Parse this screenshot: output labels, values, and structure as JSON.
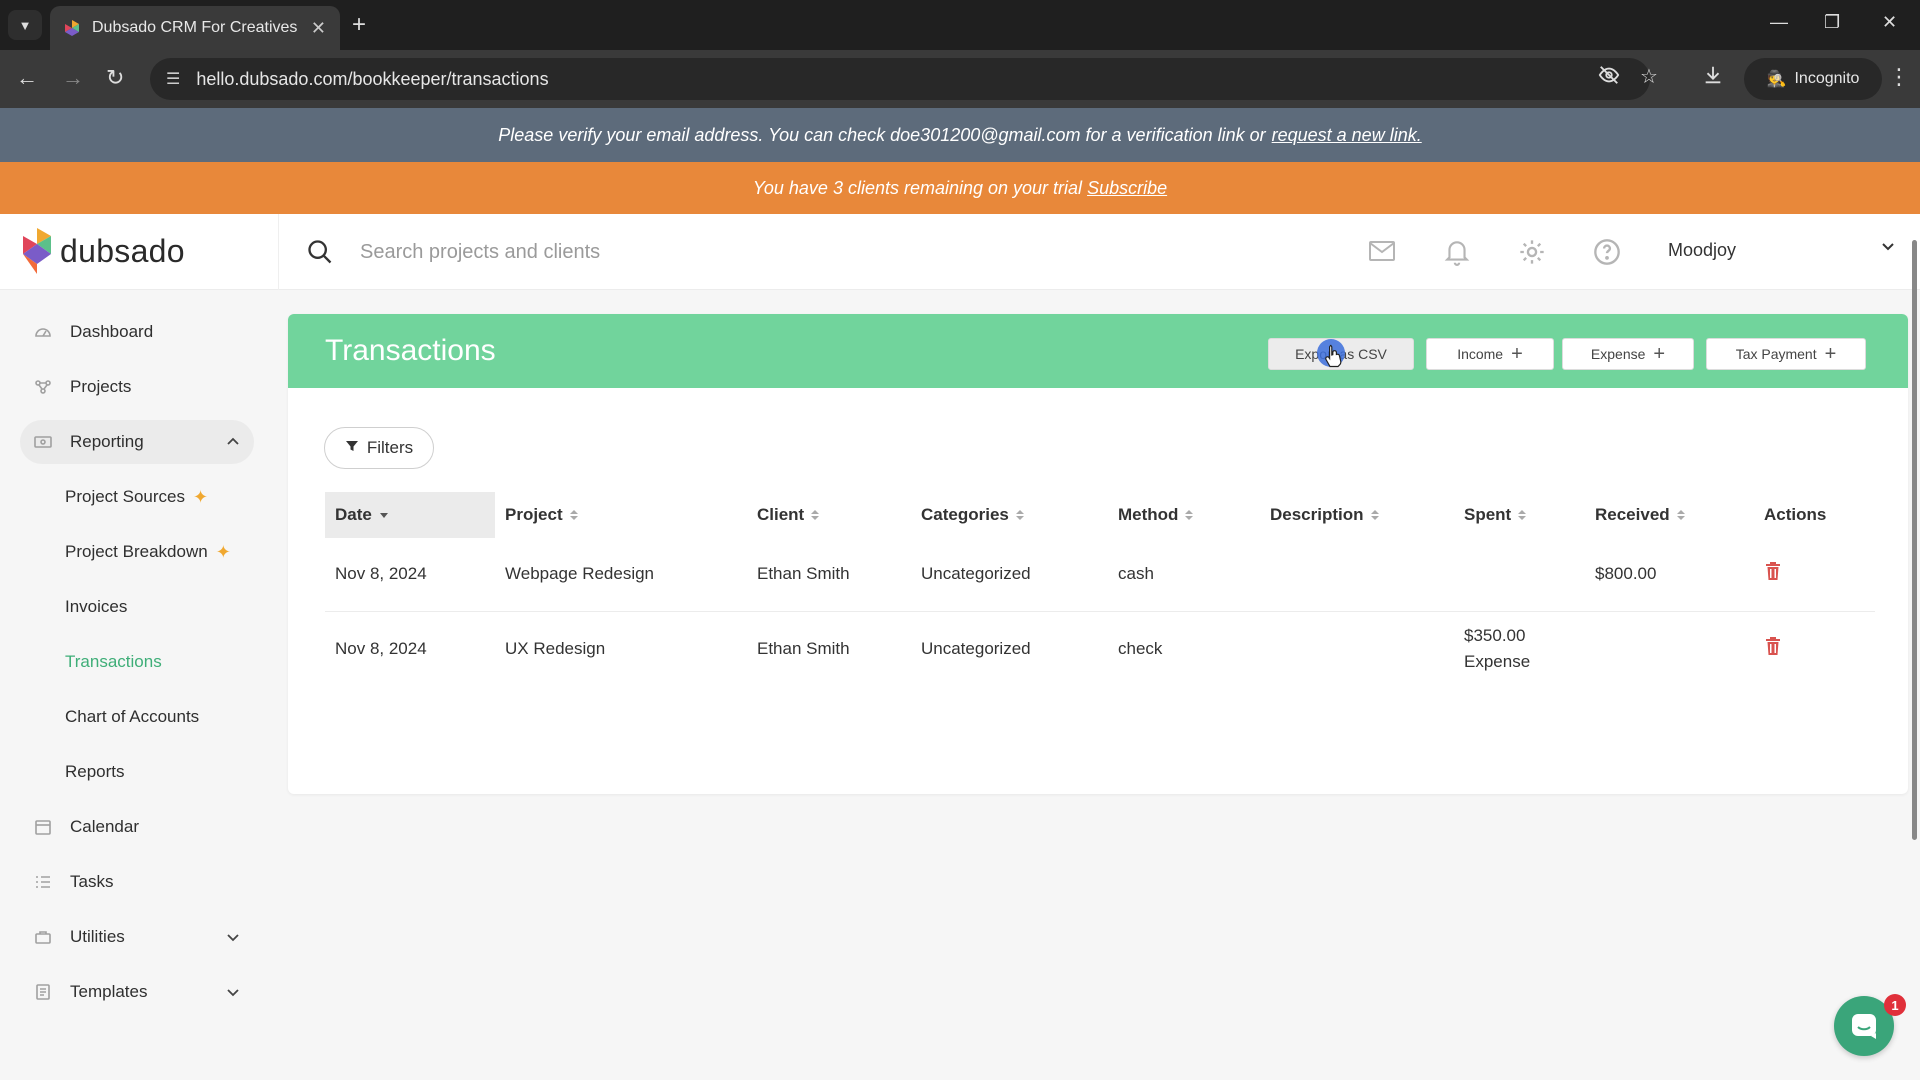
{
  "browser": {
    "tab_title": "Dubsado CRM For Creatives",
    "url": "hello.dubsado.com/bookkeeper/transactions",
    "incognito_label": "Incognito"
  },
  "banners": {
    "verify_text": "Please verify your email address. You can check doe301200@gmail.com for a verification link or",
    "verify_link": "request a new link.",
    "trial_text": "You have 3 clients remaining on your trial",
    "trial_link": "Subscribe"
  },
  "header": {
    "logo_text": "dubsado",
    "search_placeholder": "Search projects and clients",
    "search_value": "",
    "user_name": "Moodjoy"
  },
  "sidebar": {
    "items": [
      {
        "label": "Dashboard",
        "icon": "gauge-icon"
      },
      {
        "label": "Projects",
        "icon": "projects-icon"
      },
      {
        "label": "Reporting",
        "icon": "reporting-icon",
        "expanded": true
      },
      {
        "label": "Calendar",
        "icon": "calendar-icon"
      },
      {
        "label": "Tasks",
        "icon": "tasks-icon"
      },
      {
        "label": "Utilities",
        "icon": "utilities-icon",
        "expanded": false
      },
      {
        "label": "Templates",
        "icon": "templates-icon",
        "expanded": false
      }
    ],
    "reporting_children": [
      {
        "label": "Project Sources",
        "new": true
      },
      {
        "label": "Project Breakdown",
        "new": true
      },
      {
        "label": "Invoices"
      },
      {
        "label": "Transactions",
        "current": true
      },
      {
        "label": "Chart of Accounts"
      },
      {
        "label": "Reports"
      }
    ]
  },
  "page": {
    "title": "Transactions",
    "buttons": {
      "export": "Export as CSV",
      "income": "Income",
      "expense": "Expense",
      "tax_payment": "Tax Payment"
    },
    "filters_label": "Filters"
  },
  "table": {
    "columns": [
      "Date",
      "Project",
      "Client",
      "Categories",
      "Method",
      "Description",
      "Spent",
      "Received",
      "Actions"
    ],
    "rows": [
      {
        "date": "Nov 8, 2024",
        "project": "Webpage Redesign",
        "client": "Ethan Smith",
        "category": "Uncategorized",
        "method": "cash",
        "description": "",
        "spent": "",
        "spent_type": "",
        "received": "$800.00"
      },
      {
        "date": "Nov 8, 2024",
        "project": "UX Redesign",
        "client": "Ethan Smith",
        "category": "Uncategorized",
        "method": "check",
        "description": "",
        "spent": "$350.00",
        "spent_type": "Expense",
        "received": ""
      }
    ]
  },
  "chat": {
    "badge_count": "1"
  },
  "colors": {
    "accent_green": "#71d49c",
    "active_link": "#3fae78",
    "trial_orange": "#e8883a",
    "verify_slate": "#5d6b7b",
    "delete_red": "#d9534f"
  }
}
